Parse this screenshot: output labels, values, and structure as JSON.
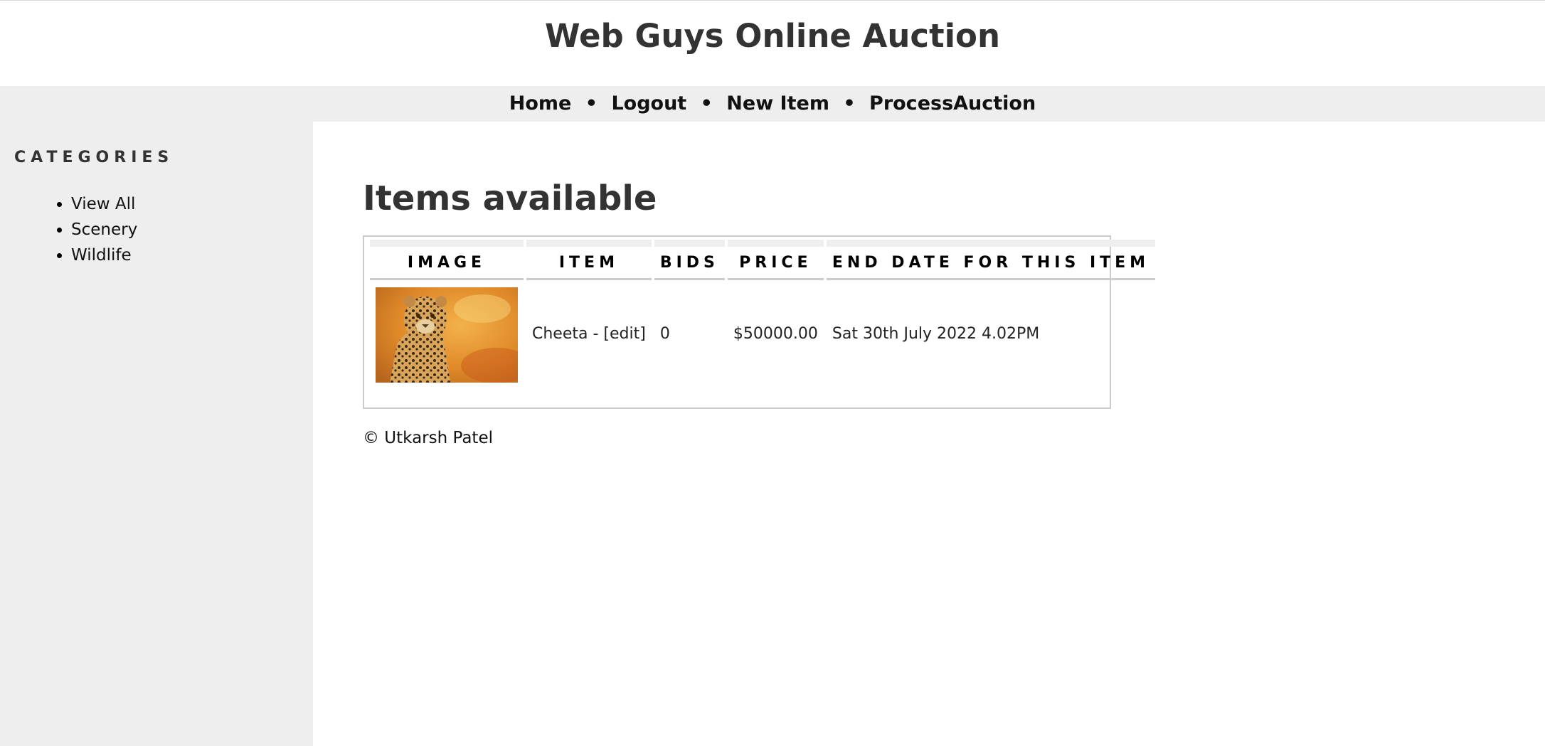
{
  "header": {
    "title": "Web Guys Online Auction"
  },
  "nav": {
    "items": [
      {
        "label": "Home"
      },
      {
        "label": "Logout"
      },
      {
        "label": "New Item"
      },
      {
        "label": "ProcessAuction"
      }
    ],
    "separator": "•"
  },
  "sidebar": {
    "heading": "CATEGORIES",
    "items": [
      {
        "label": "View All"
      },
      {
        "label": "Scenery"
      },
      {
        "label": "Wildlife"
      }
    ]
  },
  "main": {
    "title": "Items available",
    "table": {
      "columns": [
        "IMAGE",
        "ITEM",
        "BIDS",
        "PRICE",
        "END DATE FOR THIS ITEM"
      ],
      "rows": [
        {
          "image_icon": "leopard-photo",
          "item": "Cheeta",
          "item_sep": " - ",
          "edit_label": "[edit]",
          "bids": "0",
          "price": "$50000.00",
          "end_date": "Sat 30th July 2022 4.02PM"
        }
      ]
    }
  },
  "footer": {
    "text": "© Utkarsh Patel"
  },
  "colors": {
    "nav_background": "#eeeeee",
    "heading_text": "#333333",
    "table_border": "#cccccc"
  }
}
